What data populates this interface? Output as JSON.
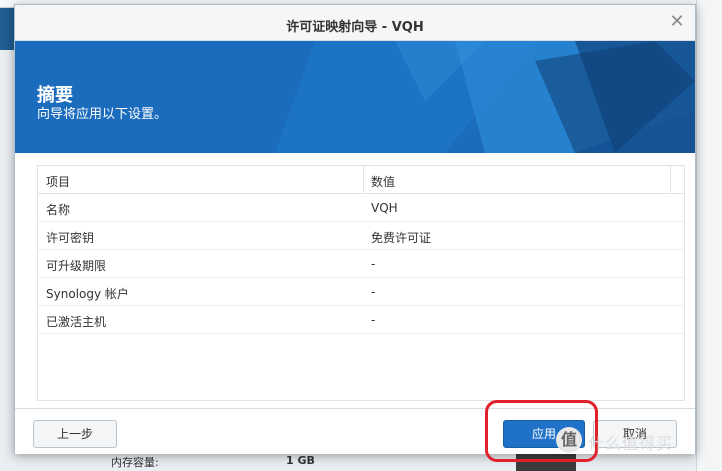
{
  "dialog": {
    "title": "许可证映射向导 - VQH",
    "close_glyph": "✕"
  },
  "banner": {
    "title": "摘要",
    "subtitle": "向导将应用以下设置。"
  },
  "table": {
    "columns": [
      "项目",
      "数值"
    ],
    "rows": [
      [
        "名称",
        "VQH"
      ],
      [
        "许可密钥",
        "免费许可证"
      ],
      [
        "可升级期限",
        "-"
      ],
      [
        "Synology 帐户",
        "-"
      ],
      [
        "已激活主机",
        "-"
      ]
    ]
  },
  "footer": {
    "back_label": "上一步",
    "apply_label": "应用",
    "cancel_label": "取消"
  },
  "background": {
    "memory_label": "内存容量:",
    "memory_value": "1 GB"
  },
  "watermark": {
    "icon_glyph": "值",
    "text": "什么值得买"
  },
  "colors": {
    "accent": "#1f72c8",
    "highlight": "#e0202a",
    "banner": "#1a6fbf"
  }
}
